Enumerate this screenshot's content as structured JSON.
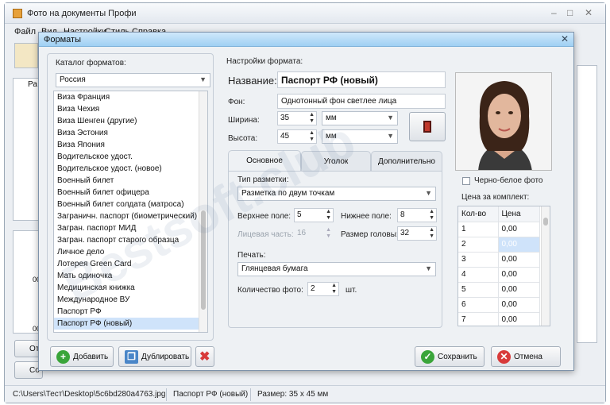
{
  "app": {
    "title": "Фото на документы Профи",
    "menu": [
      "Файл",
      "Вид",
      "Настройки",
      "Стиль",
      "Справка"
    ],
    "left_tab": "Ра",
    "left_buttons": [
      "Отк",
      "Со"
    ],
    "thumb_labels": [
      "00",
      "00"
    ],
    "status": {
      "path": "C:\\Users\\Тест\\Desktop\\5c6bd280a4763.jpg",
      "format": "Паспорт РФ (новый)",
      "size": "Размер: 35 х 45 мм"
    }
  },
  "dialog": {
    "title": "Форматы",
    "catalog_label": "Каталог форматов:",
    "country": "Россия",
    "formats": [
      "Виза Франция",
      "Виза Чехия",
      "Виза Шенген (другие)",
      "Виза Эстония",
      "Виза Япония",
      "Водительское удост.",
      "Водительское удост. (новое)",
      "Военный билет",
      "Военный билет офицера",
      "Военный билет солдата (матроса)",
      "Заграничн. паспорт (биометрический)",
      "Загран. паспорт МИД",
      "Загран. паспорт старого образца",
      "Личное дело",
      "Лотерея Green Card",
      "Мать одиночка",
      "Медицинская книжка",
      "Международное ВУ",
      "Паспорт РФ",
      "Паспорт РФ (новый)"
    ],
    "selected_format": "Паспорт РФ (новый)",
    "settings_label": "Настройки формата:",
    "name_label": "Название:",
    "name_value": "Паспорт РФ (новый)",
    "bg_label": "Фон:",
    "bg_value": "Однотонный фон светлее лица",
    "width_label": "Ширина:",
    "width_value": "35",
    "height_label": "Высота:",
    "height_value": "45",
    "unit": "мм",
    "tabs": [
      "Основное",
      "Уголок",
      "Дополнительно"
    ],
    "markup_label": "Тип разметки:",
    "markup_value": "Разметка по двум точкам",
    "top_margin_label": "Верхнее поле:",
    "top_margin_value": "5",
    "bottom_margin_label": "Нижнее поле:",
    "bottom_margin_value": "8",
    "face_label": "Лицевая часть:",
    "face_value": "16",
    "head_label": "Размер головы:",
    "head_value": "32",
    "print_label": "Печать:",
    "print_value": "Глянцевая бумага",
    "qty_label": "Количество фото:",
    "qty_value": "2",
    "qty_unit": "шт.",
    "bw_label": "Черно-белое фото",
    "price_label": "Цена за комплект:",
    "price_headers": [
      "Кол-во",
      "Цена"
    ],
    "price_rows": [
      [
        "1",
        "0,00"
      ],
      [
        "2",
        "0,00"
      ],
      [
        "3",
        "0,00"
      ],
      [
        "4",
        "0,00"
      ],
      [
        "5",
        "0,00"
      ],
      [
        "6",
        "0,00"
      ],
      [
        "7",
        "0,00"
      ]
    ],
    "buttons": {
      "add": "Добавить",
      "duplicate": "Дублировать",
      "save": "Сохранить",
      "cancel": "Отмена"
    },
    "colors": {
      "accent": "#9fd0f3",
      "save": "#3aa53a",
      "cancel": "#d83a3a",
      "add": "#3aa53a"
    }
  },
  "watermark": "Bestsoft.club"
}
